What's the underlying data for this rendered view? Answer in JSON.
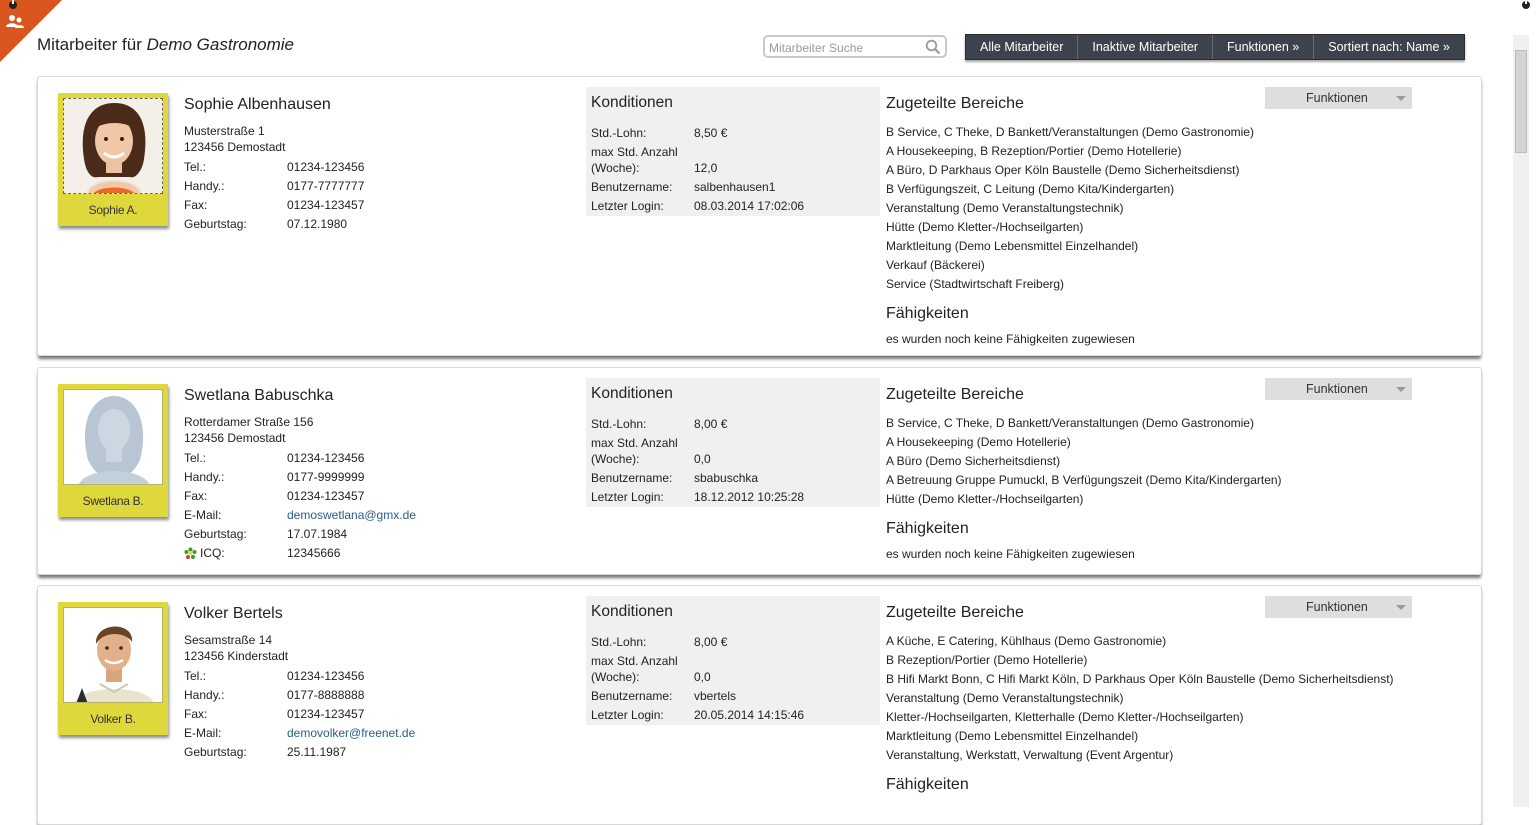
{
  "page": {
    "title_prefix": "Mitarbeiter für",
    "title_company": "Demo Gastronomie"
  },
  "search": {
    "placeholder": "Mitarbeiter Suche",
    "value": ""
  },
  "toolbar": {
    "all": "Alle Mitarbeiter",
    "inactive": "Inaktive Mitarbeiter",
    "functions": "Funktionen »",
    "sort": "Sortiert nach: Name »"
  },
  "labels": {
    "conditions": "Konditionen",
    "wage": "Std.-Lohn:",
    "max_hours_1": "max Std. Anzahl",
    "max_hours_2": "(Woche):",
    "username": "Benutzername:",
    "last_login": "Letzter Login:",
    "areas": "Zugeteilte Bereiche",
    "skills": "Fähigkeiten",
    "functions_button": "Funktionen",
    "tel": "Tel.:",
    "mobile": "Handy.:",
    "fax": "Fax:",
    "email": "E-Mail:",
    "birthday": "Geburtstag:",
    "icq": "ICQ:"
  },
  "employees": [
    {
      "photo_caption": "Sophie A.",
      "name": "Sophie Albenhausen",
      "street": "Musterstraße 1",
      "city": "123456 Demostadt",
      "tel": "01234-123456",
      "mobile": "0177-7777777",
      "fax": "01234-123457",
      "birthday": "07.12.1980",
      "wage": "8,50 €",
      "max_hours": "12,0",
      "username": "salbenhausen1",
      "last_login": "08.03.2014 17:02:06",
      "areas": [
        "B Service, C Theke, D Bankett/Veranstaltungen  (Demo Gastronomie)",
        "A Housekeeping, B Rezeption/Portier  (Demo Hotellerie)",
        "A Büro, D Parkhaus Oper Köln Baustelle  (Demo Sicherheitsdienst)",
        "B Verfügungszeit, C Leitung  (Demo Kita/Kindergarten)",
        "Veranstaltung  (Demo Veranstaltungstechnik)",
        "Hütte  (Demo Kletter-/Hochseilgarten)",
        "Marktleitung  (Demo Lebensmittel Einzelhandel)",
        "Verkauf  (Bäckerei)",
        "Service  (Stadtwirtschaft Freiberg)"
      ],
      "skills": "es wurden noch keine Fähigkeiten zugewiesen"
    },
    {
      "photo_caption": "Swetlana B.",
      "name": "Swetlana Babuschka",
      "street": "Rotterdamer Straße 156",
      "city": "123456 Demostadt",
      "tel": "01234-123456",
      "mobile": "0177-9999999",
      "fax": "01234-123457",
      "email": "demoswetlana@gmx.de",
      "birthday": "17.07.1984",
      "icq": "12345666",
      "wage": "8,00 €",
      "max_hours": "0,0",
      "username": "sbabuschka",
      "last_login": "18.12.2012 10:25:28",
      "areas": [
        "B Service, C Theke, D Bankett/Veranstaltungen  (Demo Gastronomie)",
        "A Housekeeping  (Demo Hotellerie)",
        "A Büro  (Demo Sicherheitsdienst)",
        "A Betreuung Gruppe Pumuckl, B Verfügungszeit  (Demo Kita/Kindergarten)",
        "Hütte  (Demo Kletter-/Hochseilgarten)"
      ],
      "skills": "es wurden noch keine Fähigkeiten zugewiesen"
    },
    {
      "photo_caption": "Volker B.",
      "name": "Volker Bertels",
      "street": "Sesamstraße 14",
      "city": "123456 Kinderstadt",
      "tel": "01234-123456",
      "mobile": "0177-8888888",
      "fax": "01234-123457",
      "email": "demovolker@freenet.de",
      "birthday": "25.11.1987",
      "wage": "8,00 €",
      "max_hours": "0,0",
      "username": "vbertels",
      "last_login": "20.05.2014 14:15:46",
      "areas": [
        "A Küche, E Catering, Kühlhaus  (Demo Gastronomie)",
        "B Rezeption/Portier  (Demo Hotellerie)",
        "B Hifi Markt Bonn, C Hifi Markt Köln, D Parkhaus Oper Köln Baustelle  (Demo Sicherheitsdienst)",
        "Veranstaltung  (Demo Veranstaltungstechnik)",
        "Kletter-/Hochseilgarten, Kletterhalle  (Demo Kletter-/Hochseilgarten)",
        "Marktleitung  (Demo Lebensmittel Einzelhandel)",
        "Veranstaltung, Werkstatt, Verwaltung  (Event Argentur)"
      ],
      "skills": ""
    }
  ]
}
